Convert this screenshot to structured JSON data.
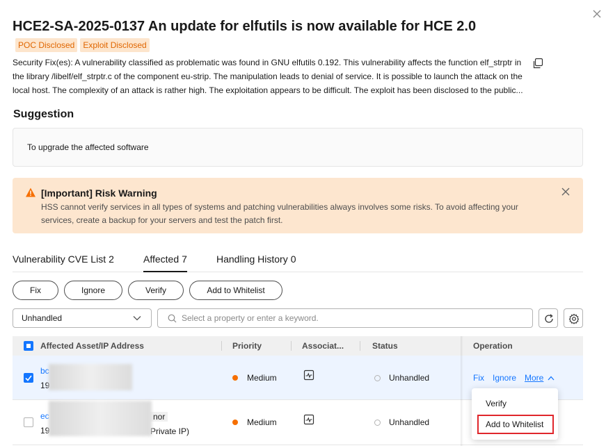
{
  "dialog": {
    "title": "HCE2-SA-2025-0137 An update for elfutils is now available for HCE 2.0",
    "tags": [
      "POC Disclosed",
      "Exploit Disclosed"
    ],
    "description_lines": [
      "Security Fix(es): A vulnerability classified as problematic was found in GNU elfutils 0.192. This vulnerability affects the function elf_strptr in",
      "the library /libelf/elf_strptr.c of the component eu-strip. The manipulation leads to denial of service. It is possible to launch the attack on the",
      "local host. The complexity of an attack is rather high. The exploitation appears to be difficult. The exploit has been disclosed to the public..."
    ]
  },
  "suggestion": {
    "heading": "Suggestion",
    "text": "To upgrade the affected software"
  },
  "warning": {
    "title": "[Important] Risk Warning",
    "text": "HSS cannot verify services in all types of systems and patching vulnerabilities always involves some risks. To avoid affecting your services, create a backup for your servers and test the patch first."
  },
  "tabs": [
    {
      "label": "Vulnerability CVE List",
      "count": "2"
    },
    {
      "label": "Affected",
      "count": "7"
    },
    {
      "label": "Handling History",
      "count": "0"
    }
  ],
  "toolbar": {
    "fix": "Fix",
    "ignore": "Ignore",
    "verify": "Verify",
    "whitelist": "Add to Whitelist"
  },
  "filter": {
    "status_value": "Unhandled",
    "search_placeholder": "Select a property or enter a keyword."
  },
  "table": {
    "headers": {
      "asset": "Affected Asset/IP Address",
      "priority": "Priority",
      "assoc": "Associat...",
      "status": "Status",
      "operation": "Operation"
    },
    "rows": [
      {
        "asset_name": "bc",
        "asset_ip": "19",
        "priority": "Medium",
        "status": "Unhandled",
        "ops": {
          "fix": "Fix",
          "ignore": "Ignore",
          "more": "More"
        }
      },
      {
        "asset_name": "ec",
        "asset_suffix": "nor",
        "asset_ip": "19",
        "asset_ip_suffix": "Private IP)",
        "priority": "Medium",
        "status": "Unhandled"
      }
    ],
    "more_menu": [
      "Verify",
      "Add to Whitelist"
    ]
  },
  "colors": {
    "accent": "#1476ff",
    "warning_bg": "#fde6cf",
    "tag_bg": "#fde5cc",
    "tag_text": "#e06600",
    "medium_priority": "#f66f00",
    "highlight_border": "#e0262b"
  }
}
